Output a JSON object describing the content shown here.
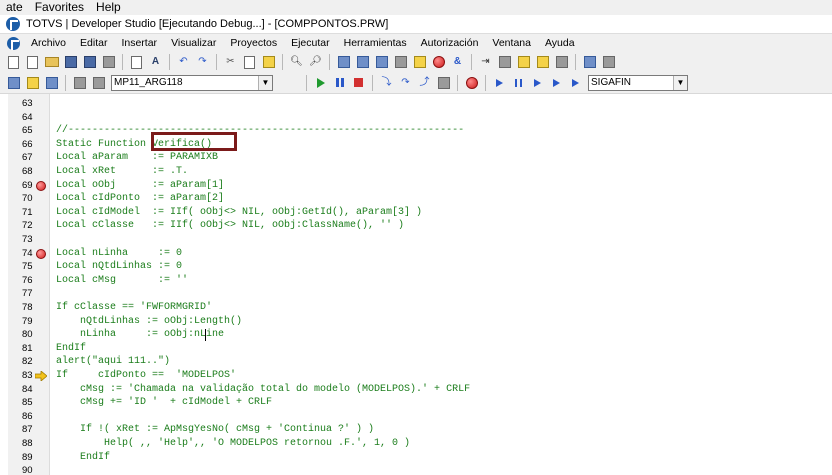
{
  "browser_menu": [
    "ate",
    "Favorites",
    "Help"
  ],
  "window": {
    "title": "TOTVS | Developer Studio [Ejecutando Debug...] - [COMPPONTOS.PRW]"
  },
  "menu": [
    "Archivo",
    "Editar",
    "Insertar",
    "Visualizar",
    "Proyectos",
    "Ejecutar",
    "Herramientas",
    "Autorización",
    "Ventana",
    "Ayuda"
  ],
  "toolbar": {
    "environment": "MP11_ARG118",
    "system": "SIGAFIN"
  },
  "editor": {
    "colors": {
      "code": "#1b7d1b",
      "highlight_box": "#7b1a1a",
      "breakpoint": "#d21d1d",
      "exec_arrow": "#f2c21b"
    },
    "lines": [
      {
        "num": "63",
        "text": ""
      },
      {
        "num": "64",
        "text": ""
      },
      {
        "num": "65",
        "text": "//------------------------------------------------------------------"
      },
      {
        "num": "66",
        "text": "Static Function Verifica()"
      },
      {
        "num": "67",
        "text": "Local aParam    := PARAMIXB"
      },
      {
        "num": "68",
        "text": "Local xRet      := .T."
      },
      {
        "num": "69",
        "text": "Local oObj      := aParam[1]",
        "breakpoint": true
      },
      {
        "num": "70",
        "text": "Local cIdPonto  := aParam[2]"
      },
      {
        "num": "71",
        "text": "Local cIdModel  := IIf( oObj<> NIL, oObj:GetId(), aParam[3] )"
      },
      {
        "num": "72",
        "text": "Local cClasse   := IIf( oObj<> NIL, oObj:ClassName(), '' )"
      },
      {
        "num": "73",
        "text": ""
      },
      {
        "num": "74",
        "text": "Local nLinha     := 0",
        "breakpoint": true
      },
      {
        "num": "75",
        "text": "Local nQtdLinhas := 0"
      },
      {
        "num": "76",
        "text": "Local cMsg       := ''"
      },
      {
        "num": "77",
        "text": ""
      },
      {
        "num": "78",
        "text": "If cClasse == 'FWFORMGRID'"
      },
      {
        "num": "79",
        "text": "    nQtdLinhas := oObj:Length()"
      },
      {
        "num": "80",
        "text": "    nLinha     := oObj:nLine"
      },
      {
        "num": "81",
        "text": "EndIf"
      },
      {
        "num": "82",
        "text": "alert(\"aqui 111..\")"
      },
      {
        "num": "83",
        "text": "If     cIdPonto ==  'MODELPOS'",
        "exec": true
      },
      {
        "num": "84",
        "text": "    cMsg := 'Chamada na validação total do modelo (MODELPOS).' + CRLF"
      },
      {
        "num": "85",
        "text": "    cMsg += 'ID '  + cIdModel + CRLF"
      },
      {
        "num": "86",
        "text": ""
      },
      {
        "num": "87",
        "text": "    If !( xRet := ApMsgYesNo( cMsg + 'Continua ?' ) )"
      },
      {
        "num": "88",
        "text": "        Help( ,, 'Help',, 'O MODELPOS retornou .F.', 1, 0 )"
      },
      {
        "num": "89",
        "text": "    EndIf"
      },
      {
        "num": "90",
        "text": ""
      }
    ]
  }
}
